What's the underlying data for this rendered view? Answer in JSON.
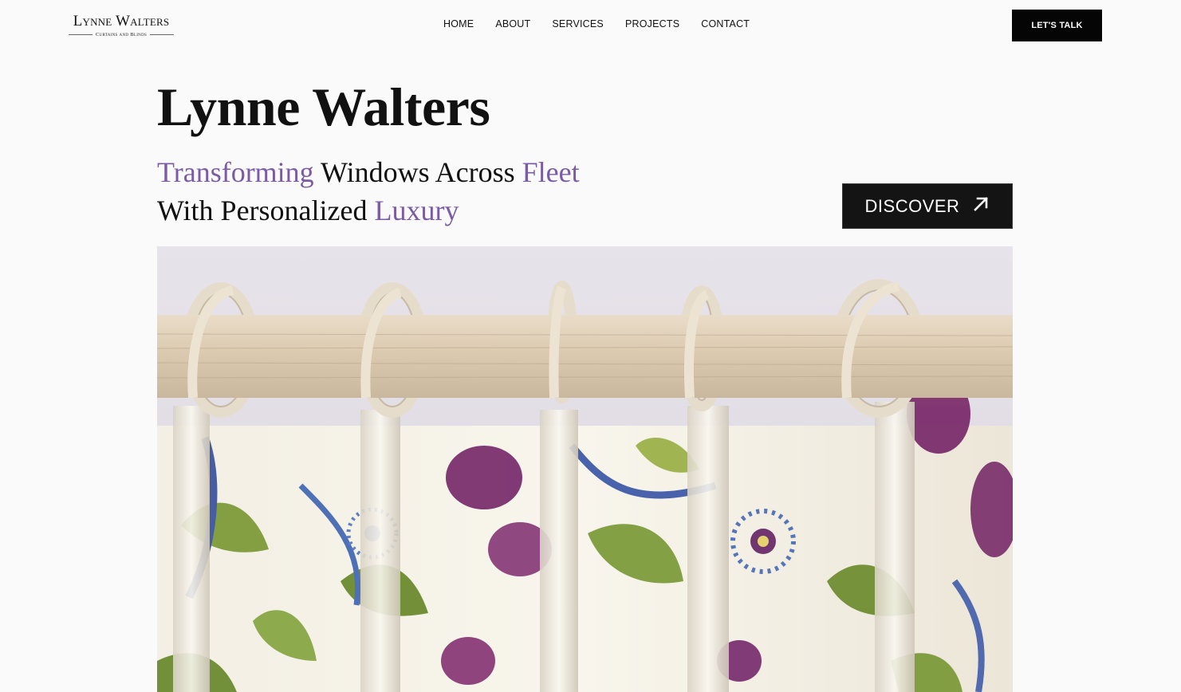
{
  "header": {
    "logo": {
      "name": "Lynne Walters",
      "tagline": "Curtains and Blinds"
    },
    "nav": [
      {
        "label": "HOME"
      },
      {
        "label": "ABOUT"
      },
      {
        "label": "SERVICES"
      },
      {
        "label": "PROJECTS"
      },
      {
        "label": "CONTACT"
      }
    ],
    "cta_label": "LET'S TALK"
  },
  "hero": {
    "title": "Lynne Walters",
    "tagline": {
      "part1_accent": "Transforming",
      "part2": " Windows Across ",
      "part3_accent": "Fleet",
      "part4": "With Personalized ",
      "part5_accent": "Luxury"
    },
    "discover_label": "DISCOVER",
    "discover_icon": "arrow-up-right-icon",
    "image_subject": "floral-curtains-on-wooden-pole"
  },
  "colors": {
    "accent": "#7b5aa6",
    "button_bg": "#141414",
    "background": "#fafafa"
  }
}
